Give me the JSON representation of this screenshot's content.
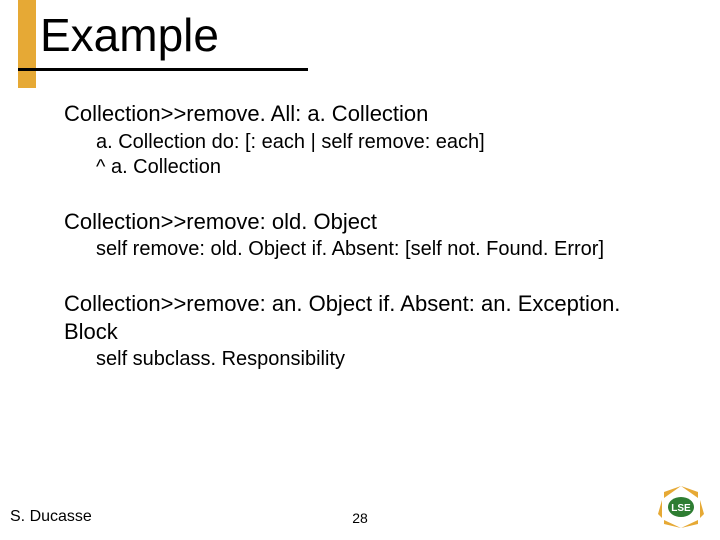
{
  "title": "Example",
  "blocks": [
    {
      "signature": "Collection>>remove. All: a. Collection",
      "body": [
        "a. Collection do: [: each | self remove: each]",
        "^ a. Collection"
      ]
    },
    {
      "signature": "Collection>>remove: old. Object",
      "body": [
        "self remove: old. Object if. Absent: [self not. Found. Error]"
      ]
    },
    {
      "signature": "Collection>>remove: an. Object if. Absent: an. Exception. Block",
      "body": [
        "self subclass. Responsibility"
      ]
    }
  ],
  "footer": {
    "author": "S. Ducasse",
    "page": "28"
  },
  "logo": {
    "name": "lse-logo",
    "arrowColor": "#e6a935",
    "badgeColor": "#2e7d32",
    "text": "LSE"
  }
}
